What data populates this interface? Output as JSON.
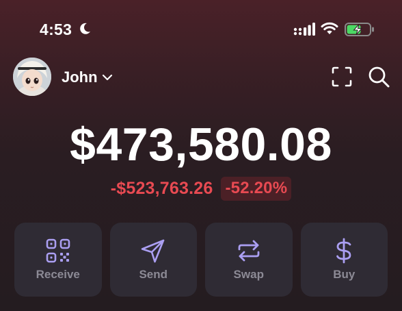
{
  "status_bar": {
    "time": "4:53",
    "moon_icon": "moon-icon",
    "signal_icon": "cellular-signal-icon",
    "wifi_icon": "wifi-icon",
    "battery_icon": "battery-charging-icon"
  },
  "header": {
    "account_name": "John",
    "avatar_icon": "avatar",
    "scan_icon": "scan-icon",
    "search_icon": "search-icon"
  },
  "portfolio": {
    "balance": "$473,580.08",
    "change_amount": "-$523,763.26",
    "change_percent": "-52.20%"
  },
  "actions": [
    {
      "label": "Receive",
      "icon": "qr-code-icon"
    },
    {
      "label": "Send",
      "icon": "send-icon"
    },
    {
      "label": "Swap",
      "icon": "swap-icon"
    },
    {
      "label": "Buy",
      "icon": "dollar-icon"
    }
  ],
  "colors": {
    "accent_purple": "#ab9ff2",
    "negative_red": "#e84a52",
    "battery_green": "#4cd964",
    "card_bg": "#2f2b34"
  }
}
